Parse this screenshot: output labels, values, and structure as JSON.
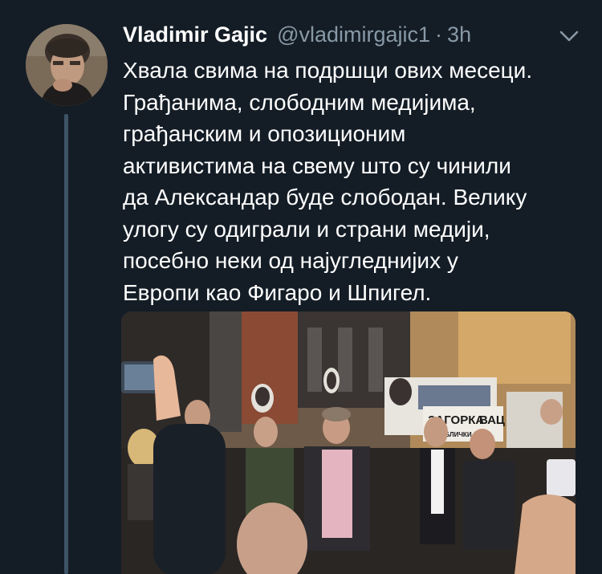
{
  "tweet": {
    "author_name": "Vladimir Gajic",
    "author_handle": "@vladimirgajic1",
    "separator": "·",
    "timestamp": "3h",
    "text_lines": [
      "Хвала свима на подршци ових месеци.",
      "Грађанима, слободним медијима,",
      "грађанским и опозиционим",
      "активистима на свему што су чинили",
      "да Александар буде слободан. Велику",
      "улогу су одиграли и страни медији,",
      "посебно неки од најугледнијих у",
      "Европи као Фигаро и Шпигел."
    ],
    "photo_sign_text": "ЗАГОРКА",
    "photo_sign_subtext": "РЕПУБЛИЧКИ",
    "photo_sign_text2": "ВАЦ"
  },
  "icons": {
    "menu": "chevron-down-icon",
    "avatar": "avatar"
  },
  "colors": {
    "background": "#141d26",
    "secondary_text": "#8899a6",
    "thread_line": "#3d5466"
  }
}
